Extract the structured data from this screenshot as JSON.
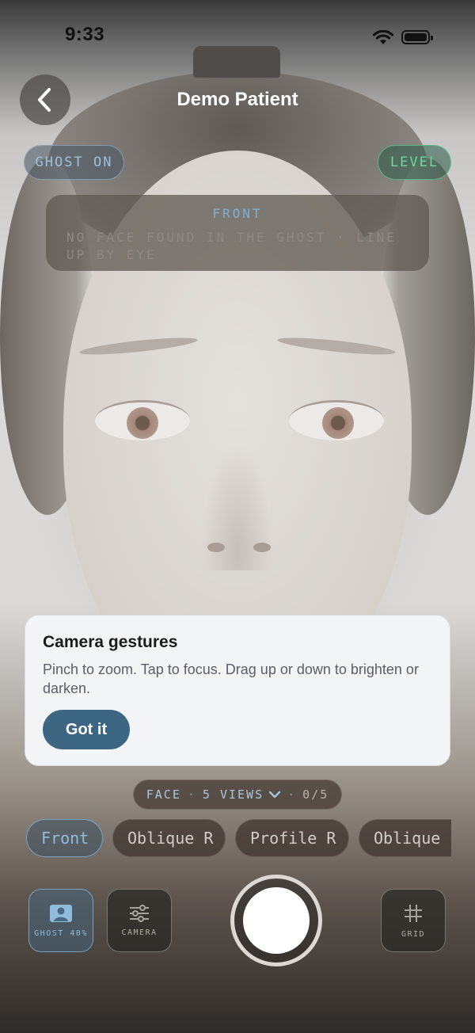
{
  "status_bar": {
    "time": "9:33",
    "icons": [
      "wifi-icon",
      "battery-icon"
    ]
  },
  "nav": {
    "back_icon": "chevron-left-icon",
    "title": "Demo Patient"
  },
  "toggles": {
    "ghost": "GHOST ON",
    "level": "LEVEL"
  },
  "hint": {
    "title": "FRONT",
    "text": "NO FACE FOUND IN THE GHOST · LINE UP BY EYE"
  },
  "tooltip": {
    "title": "Camera gestures",
    "body": "Pinch to zoom. Tap to focus. Drag up or down to brighten or darken.",
    "button": "Got it"
  },
  "view_selector": {
    "mode": "FACE",
    "views": "5 VIEWS",
    "progress": "0/5",
    "icon": "chevron-down-icon"
  },
  "views": [
    {
      "label": "Front",
      "active": true
    },
    {
      "label": "Oblique R",
      "active": false
    },
    {
      "label": "Profile R",
      "active": false
    },
    {
      "label": "Oblique L",
      "active": false
    }
  ],
  "controls": {
    "ghost_opacity": {
      "label": "GHOST 40%",
      "icon": "person-icon"
    },
    "camera": {
      "label": "CAMERA",
      "icon": "sliders-icon"
    },
    "grid": {
      "label": "GRID",
      "icon": "grid-icon"
    }
  },
  "colors": {
    "accent_blue": "#3d6683",
    "level_green": "#6fd6a5",
    "ghost_blue": "#9cc0db"
  }
}
